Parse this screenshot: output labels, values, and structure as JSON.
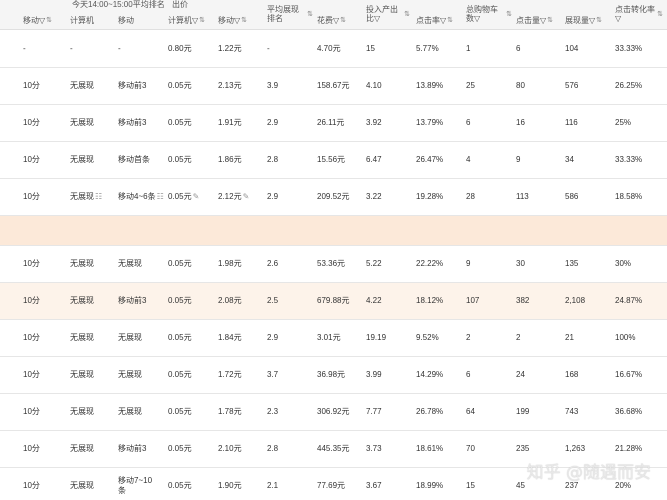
{
  "header": {
    "group_time": "今天14:00~15:00平均排名",
    "group_bid": "出价",
    "cols": [
      {
        "key": "c0",
        "label": "移动▽↑⇅",
        "text": "移动▽"
      },
      {
        "key": "c1",
        "label": "计算机",
        "text": "计算机"
      },
      {
        "key": "c2",
        "label": "移动",
        "text": "移动"
      },
      {
        "key": "c3",
        "label": "计算机▽⇅",
        "text": "计算机▽"
      },
      {
        "key": "c4",
        "label": "移动▽⇅",
        "text": "移动▽"
      },
      {
        "key": "c5",
        "label": "平均展现排名▽⇅",
        "text": "平均展现排名"
      },
      {
        "key": "c6",
        "label": "花费▽⇅",
        "text": "花费▽"
      },
      {
        "key": "c7",
        "label": "投入产出比▽",
        "text": "投入产出比▽"
      },
      {
        "key": "c8",
        "label": "点击率▽⇅",
        "text": "点击率▽"
      },
      {
        "key": "c9",
        "label": "总购物车数▽",
        "text": "总购物车数▽"
      },
      {
        "key": "c10",
        "label": "点击量▽⇅",
        "text": "点击量▽"
      },
      {
        "key": "c11",
        "label": "展现量▽⇅",
        "text": "展现量▽"
      },
      {
        "key": "c12",
        "label": "点击转化率▽",
        "text": "点击转化率▽"
      }
    ],
    "sort_glyph": "⇅"
  },
  "rows": [
    {
      "c0": "-",
      "c1": "-",
      "c2": "-",
      "c3": "0.80元",
      "c4": "1.22元",
      "c5": "-",
      "c6": "4.70元",
      "c7": "15",
      "c8": "5.77%",
      "c9": "1",
      "c10": "6",
      "c11": "104",
      "c12": "33.33%"
    },
    {
      "c0": "10分",
      "c1": "无展现",
      "c2": "移动前3",
      "c3": "0.05元",
      "c4": "2.13元",
      "c5": "3.9",
      "c6": "158.67元",
      "c7": "4.10",
      "c8": "13.89%",
      "c9": "25",
      "c10": "80",
      "c11": "576",
      "c12": "26.25%"
    },
    {
      "c0": "10分",
      "c1": "无展现",
      "c2": "移动前3",
      "c3": "0.05元",
      "c4": "1.91元",
      "c5": "2.9",
      "c6": "26.11元",
      "c7": "3.92",
      "c8": "13.79%",
      "c9": "6",
      "c10": "16",
      "c11": "116",
      "c12": "25%"
    },
    {
      "c0": "10分",
      "c1": "无展现",
      "c2": "移动首条",
      "c3": "0.05元",
      "c4": "1.86元",
      "c5": "2.8",
      "c6": "15.56元",
      "c7": "6.47",
      "c8": "26.47%",
      "c9": "4",
      "c10": "9",
      "c11": "34",
      "c12": "33.33%"
    },
    {
      "c0": "10分",
      "c1": "无展现",
      "c2": "移动4~6条",
      "c3": "0.05元",
      "c4": "2.12元",
      "c5": "2.9",
      "c6": "209.52元",
      "c7": "3.22",
      "c8": "19.28%",
      "c9": "28",
      "c10": "113",
      "c11": "586",
      "c12": "18.58%"
    },
    {
      "c0": "",
      "c1": "",
      "c2": "",
      "c3": "",
      "c4": "",
      "c5": "",
      "c6": "",
      "c7": "",
      "c8": "",
      "c9": "",
      "c10": "",
      "c11": "",
      "c12": ""
    },
    {
      "c0": "10分",
      "c1": "无展现",
      "c2": "无展现",
      "c3": "0.05元",
      "c4": "1.98元",
      "c5": "2.6",
      "c6": "53.36元",
      "c7": "5.22",
      "c8": "22.22%",
      "c9": "9",
      "c10": "30",
      "c11": "135",
      "c12": "30%"
    },
    {
      "c0": "10分",
      "c1": "无展现",
      "c2": "移动前3",
      "c3": "0.05元",
      "c4": "2.08元",
      "c5": "2.5",
      "c6": "679.88元",
      "c7": "4.22",
      "c8": "18.12%",
      "c9": "107",
      "c10": "382",
      "c11": "2,108",
      "c12": "24.87%"
    },
    {
      "c0": "10分",
      "c1": "无展现",
      "c2": "无展现",
      "c3": "0.05元",
      "c4": "1.84元",
      "c5": "2.9",
      "c6": "3.01元",
      "c7": "19.19",
      "c8": "9.52%",
      "c9": "2",
      "c10": "2",
      "c11": "21",
      "c12": "100%"
    },
    {
      "c0": "10分",
      "c1": "无展现",
      "c2": "无展现",
      "c3": "0.05元",
      "c4": "1.72元",
      "c5": "3.7",
      "c6": "36.98元",
      "c7": "3.99",
      "c8": "14.29%",
      "c9": "6",
      "c10": "24",
      "c11": "168",
      "c12": "16.67%"
    },
    {
      "c0": "10分",
      "c1": "无展现",
      "c2": "无展现",
      "c3": "0.05元",
      "c4": "1.78元",
      "c5": "2.3",
      "c6": "306.92元",
      "c7": "7.77",
      "c8": "26.78%",
      "c9": "64",
      "c10": "199",
      "c11": "743",
      "c12": "36.68%"
    },
    {
      "c0": "10分",
      "c1": "无展现",
      "c2": "移动前3",
      "c3": "0.05元",
      "c4": "2.10元",
      "c5": "2.8",
      "c6": "445.35元",
      "c7": "3.73",
      "c8": "18.61%",
      "c9": "70",
      "c10": "235",
      "c11": "1,263",
      "c12": "21.28%"
    },
    {
      "c0": "10分",
      "c1": "无展现",
      "c2": "移动7~10条",
      "c3": "0.05元",
      "c4": "1.90元",
      "c5": "2.1",
      "c6": "77.69元",
      "c7": "3.67",
      "c8": "18.99%",
      "c9": "15",
      "c10": "45",
      "c11": "237",
      "c12": "20%"
    }
  ],
  "edit_icons": {
    "strategy_row": 4
  },
  "watermark": "知乎 @随遇而安"
}
